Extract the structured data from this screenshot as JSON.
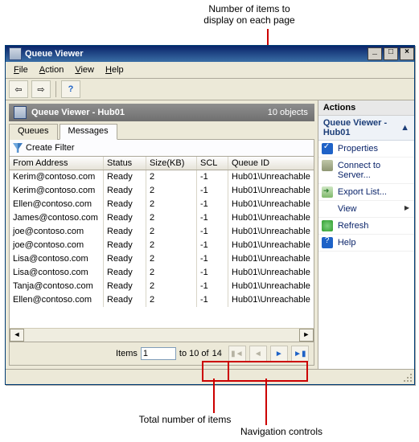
{
  "annotations": {
    "top": "Number of items to\ndisplay on each page",
    "bottom_left": "Total number of items",
    "bottom_right": "Navigation controls"
  },
  "window": {
    "title": "Queue Viewer",
    "menus": {
      "file": "File",
      "action": "Action",
      "view": "View",
      "help": "Help"
    }
  },
  "header": {
    "title": "Queue Viewer - Hub01",
    "object_count": "10 objects"
  },
  "tabs": {
    "queues": "Queues",
    "messages": "Messages"
  },
  "filter": {
    "label": "Create Filter"
  },
  "columns": {
    "from": "From Address",
    "status": "Status",
    "size": "Size(KB)",
    "scl": "SCL",
    "qid": "Queue ID"
  },
  "rows": [
    {
      "from": "Kerim@contoso.com",
      "status": "Ready",
      "size": "2",
      "scl": "-1",
      "qid": "Hub01\\Unreachable"
    },
    {
      "from": "Kerim@contoso.com",
      "status": "Ready",
      "size": "2",
      "scl": "-1",
      "qid": "Hub01\\Unreachable"
    },
    {
      "from": "Ellen@contoso.com",
      "status": "Ready",
      "size": "2",
      "scl": "-1",
      "qid": "Hub01\\Unreachable"
    },
    {
      "from": "James@contoso.com",
      "status": "Ready",
      "size": "2",
      "scl": "-1",
      "qid": "Hub01\\Unreachable"
    },
    {
      "from": "joe@contoso.com",
      "status": "Ready",
      "size": "2",
      "scl": "-1",
      "qid": "Hub01\\Unreachable"
    },
    {
      "from": "joe@contoso.com",
      "status": "Ready",
      "size": "2",
      "scl": "-1",
      "qid": "Hub01\\Unreachable"
    },
    {
      "from": "Lisa@contoso.com",
      "status": "Ready",
      "size": "2",
      "scl": "-1",
      "qid": "Hub01\\Unreachable"
    },
    {
      "from": "Lisa@contoso.com",
      "status": "Ready",
      "size": "2",
      "scl": "-1",
      "qid": "Hub01\\Unreachable"
    },
    {
      "from": "Tanja@contoso.com",
      "status": "Ready",
      "size": "2",
      "scl": "-1",
      "qid": "Hub01\\Unreachable"
    },
    {
      "from": "Ellen@contoso.com",
      "status": "Ready",
      "size": "2",
      "scl": "-1",
      "qid": "Hub01\\Unreachable"
    }
  ],
  "pager": {
    "items_label": "Items",
    "from_value": "1",
    "to_label": "to 10 of",
    "total": "14"
  },
  "actions": {
    "header": "Actions",
    "sub": "Queue Viewer - Hub01",
    "items": {
      "properties": "Properties",
      "connect": "Connect to Server...",
      "export": "Export List...",
      "view": "View",
      "refresh": "Refresh",
      "help": "Help"
    }
  }
}
